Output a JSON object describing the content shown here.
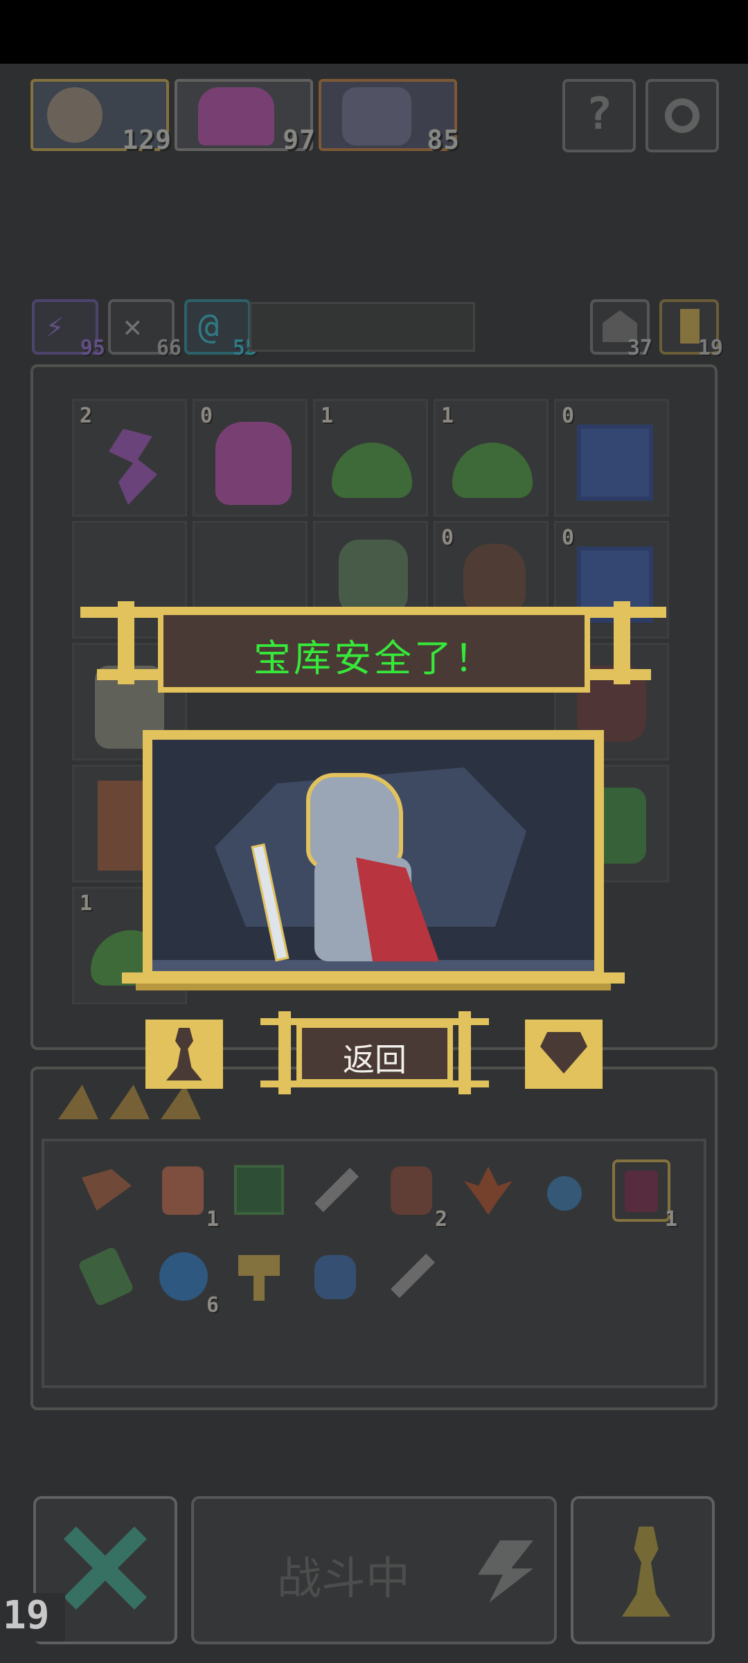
{
  "heroes": [
    {
      "name": "warrior",
      "count": "129"
    },
    {
      "name": "demon",
      "count": "97"
    },
    {
      "name": "goblin",
      "count": "85"
    }
  ],
  "resources": [
    {
      "name": "lightning",
      "value": "95",
      "color": "#8b6ac8"
    },
    {
      "name": "wings",
      "value": "66",
      "color": "#aaaaaa"
    },
    {
      "name": "magic",
      "value": "55",
      "color": "#33b6c8"
    }
  ],
  "top_right_counts": {
    "house": "37",
    "key": "19"
  },
  "grid": {
    "row1": [
      {
        "label": "2",
        "icon": "dragon-icon"
      },
      {
        "label": "0",
        "icon": "demon-icon"
      },
      {
        "label": "1",
        "icon": "slime-icon"
      },
      {
        "label": "1",
        "icon": "slime-icon"
      },
      {
        "label": "0",
        "icon": "shrine-icon"
      }
    ],
    "row2": [
      {
        "label": "",
        "icon": ""
      },
      {
        "label": "",
        "icon": ""
      },
      {
        "label": "",
        "icon": "goblin-icon"
      },
      {
        "label": "0",
        "icon": "girl-icon"
      },
      {
        "label": "0",
        "icon": "shrine-icon"
      }
    ],
    "row5_label": "1"
  },
  "inventory": {
    "items": [
      {
        "icon": "pickaxe-icon",
        "qty": ""
      },
      {
        "icon": "lantern-icon",
        "qty": "1"
      },
      {
        "icon": "map-icon",
        "qty": ""
      },
      {
        "icon": "dagger-icon",
        "qty": ""
      },
      {
        "icon": "boot-icon",
        "qty": "2"
      },
      {
        "icon": "herb-icon",
        "qty": ""
      },
      {
        "icon": "potion-icon",
        "qty": ""
      },
      {
        "icon": "jar-icon",
        "qty": "1"
      },
      {
        "icon": "vial-icon",
        "qty": ""
      },
      {
        "icon": "orb-icon",
        "qty": "6"
      },
      {
        "icon": "key-icon",
        "qty": ""
      },
      {
        "icon": "flask-icon",
        "qty": ""
      },
      {
        "icon": "sword-icon",
        "qty": ""
      }
    ]
  },
  "modal": {
    "title": "宝库安全了！",
    "back_label": "返回"
  },
  "bottom": {
    "battle_label": "战斗中",
    "turn_counter": "19"
  },
  "colors": {
    "gold": "#e2c25c",
    "title_green": "#36e83a",
    "banner_brown": "#4a3a35",
    "scene_bg": "#2b3242"
  }
}
